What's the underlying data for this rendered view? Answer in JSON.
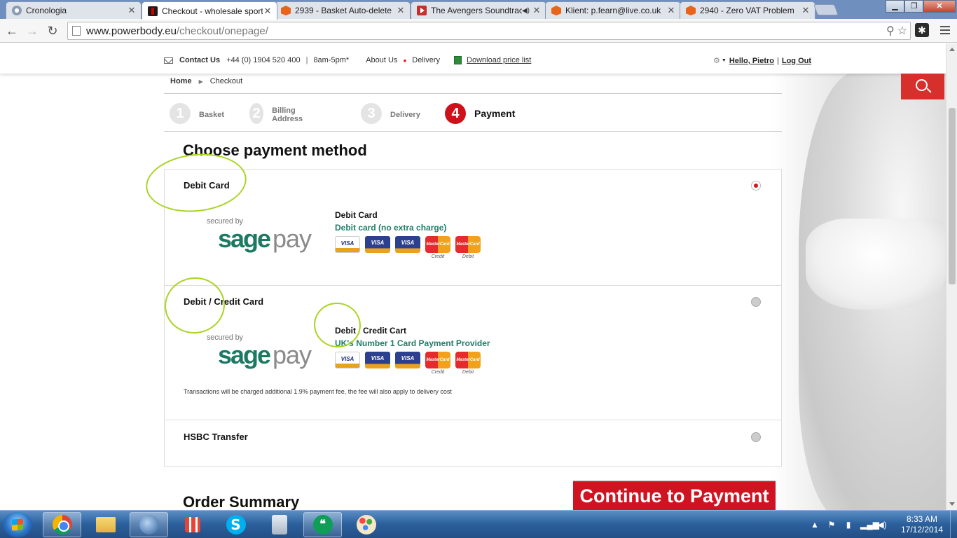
{
  "browser": {
    "tabs": [
      {
        "title": "Cronologia",
        "favicon": "history-icon"
      },
      {
        "title": "Checkout - wholesale sports",
        "favicon": "powerbody-icon"
      },
      {
        "title": "2939 - Basket Auto-delete",
        "favicon": "magento-icon"
      },
      {
        "title": "The Avengers Soundtrack",
        "favicon": "youtube-icon"
      },
      {
        "title": "Klient: p.fearn@live.co.uk",
        "favicon": "magento-icon"
      },
      {
        "title": "2940 - Zero VAT Problem",
        "favicon": "magento-icon"
      }
    ],
    "active_tab_index": 1,
    "url_host": "www.powerbody.eu",
    "url_path": "/checkout/onepage/"
  },
  "topbar": {
    "contact_label": "Contact Us",
    "phone": "+44 (0) 1904 520 400",
    "separator": "|",
    "hours": "8am-5pm*",
    "about": "About Us",
    "delivery": "Delivery",
    "download": "Download price list",
    "greeting": "Hello, Pietro",
    "logout": "Log Out",
    "link_sep": "|"
  },
  "breadcrumb": {
    "home": "Home",
    "current": "Checkout"
  },
  "steps": [
    {
      "num": "1",
      "label": "Basket"
    },
    {
      "num": "2",
      "label": "Billing Address"
    },
    {
      "num": "3",
      "label": "Delivery"
    },
    {
      "num": "4",
      "label": "Payment"
    }
  ],
  "checkout": {
    "heading": "Choose payment method",
    "sagepay_secured": "secured by",
    "sagepay_sage": "sage",
    "sagepay_pay": "pay",
    "options": [
      {
        "title": "Debit Card",
        "card_name": "Debit Card",
        "card_desc": "Debit card (no extra charge)",
        "selected": true
      },
      {
        "title": "Debit / Credit Card",
        "card_name": "Debit / Credit Cart",
        "card_desc": "UK's Number 1 Card Payment Provider",
        "note": "Transactions will be charged additional 1.9% payment fee, the fee will also apply to delivery cost",
        "selected": false
      },
      {
        "title": "HSBC Transfer",
        "selected": false
      }
    ],
    "cards": {
      "visa": "VISA",
      "visa_debit": "VISA",
      "visa_electron": "VISA",
      "mc": "MasterCard",
      "credit_sub": "Credit",
      "debit_sub": "Debit"
    },
    "order_summary": "Order Summary",
    "continue_button": "Continue to Payment"
  },
  "colors": {
    "brand_red": "#d01321",
    "sagepay_green": "#1c7a63",
    "highlight_green": "#a9d422"
  },
  "taskbar": {
    "time": "8:33 AM",
    "date": "17/12/2014"
  }
}
